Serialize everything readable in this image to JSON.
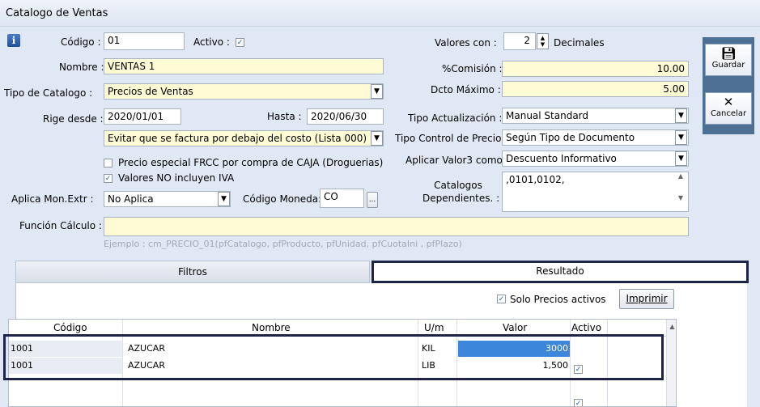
{
  "window": {
    "title": "Catalogo de Ventas"
  },
  "form": {
    "codigo_label": "Código :",
    "codigo_value": "01",
    "activo_label": "Activo :",
    "nombre_label": "Nombre :",
    "nombre_value": "VENTAS 1",
    "tipo_catalogo_label": "Tipo de Catalogo :",
    "tipo_catalogo_value": "Precios de Ventas",
    "rige_label": "Rige desde :",
    "rige_value": "2020/01/01",
    "hasta_label": "Hasta :",
    "hasta_value": "2020/06/30",
    "factura_value": "Evitar que se factura por debajo del costo (Lista 000)",
    "precio_especial_label": "Precio especial FRCC por compra de CAJA (Droguerias)",
    "valores_iva_label": "Valores NO incluyen IVA",
    "aplica_label": "Aplica Mon.Extr :",
    "aplica_value": "No Aplica",
    "codigo_moneda_label": "Código Moneda:",
    "codigo_moneda_value": "CO",
    "ellipsis": "...",
    "funcion_label": "Función Cálculo :",
    "ejemplo": "Ejemplo : cm_PRECIO_01(pfCatalogo, pfProducto, pfUnidad, pfCuotaIni , pfPlazo)",
    "valores_con_label": "Valores con :",
    "decimales_value": "2",
    "decimales_label": "Decimales",
    "comision_label": "%Comisión :",
    "comision_value": "10.00",
    "dcto_label": "Dcto Máximo :",
    "dcto_value": "5.00",
    "tipo_act_label": "Tipo Actualización :",
    "tipo_act_value": "Manual Standard",
    "tipo_control_label": "Tipo Control de Precio :",
    "tipo_control_value": "Según Tipo de Documento",
    "aplicar_label": "Aplicar Valor3 como :",
    "aplicar_value": "Descuento Informativo",
    "catalogos_label_1": "Catalogos",
    "catalogos_label_2": "Dependientes. :",
    "catalogos_value": ",0101,0102,"
  },
  "side": {
    "guardar": "Guardar",
    "cancelar": "Cancelar"
  },
  "tabs": {
    "filtros": "Filtros",
    "resultado": "Resultado"
  },
  "results": {
    "solo_label": "Solo Precios activos",
    "imprimir": "Imprimir",
    "columns": {
      "codigo": "Código",
      "nombre": "Nombre",
      "um": "U/m",
      "valor": "Valor",
      "activo": "Activo"
    },
    "rows": [
      {
        "codigo": "1001",
        "nombre": "AZUCAR",
        "um": "KIL",
        "valor": "3000"
      },
      {
        "codigo": "1001",
        "nombre": "AZUCAR",
        "um": "LIB",
        "valor": "1,500"
      }
    ]
  },
  "colors": {
    "field_yellow": "#fffbd5",
    "highlight_border": "#1d2447",
    "selected_cell": "#3c86db",
    "side_panel": "#4d6f94"
  }
}
